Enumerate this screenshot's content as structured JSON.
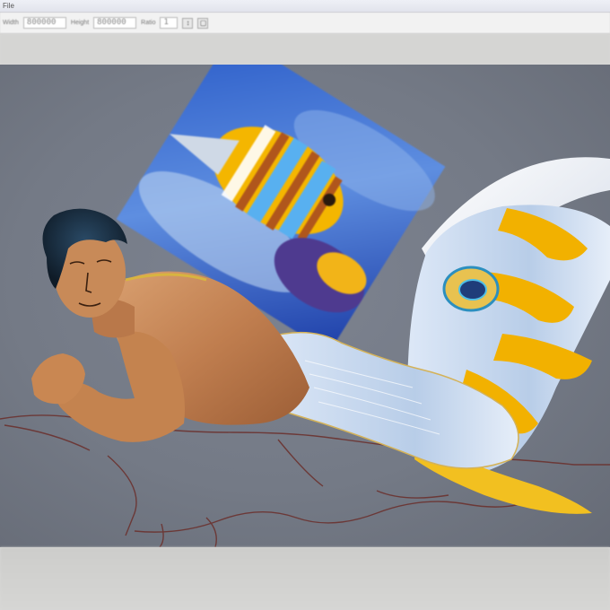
{
  "app": {
    "menu_text": "File",
    "options": [
      {
        "label": "Width",
        "value": "800000"
      },
      {
        "label": "Height",
        "value": "800000"
      },
      {
        "label": "Ratio",
        "value": "1"
      }
    ],
    "option_buttons": [
      "↕",
      "▢"
    ]
  },
  "canvas": {
    "background_color": "#747a86",
    "reference_image": "butterflyfish-photo",
    "artwork": "merman-illustration-with-yellow-blue-striped-tail"
  }
}
